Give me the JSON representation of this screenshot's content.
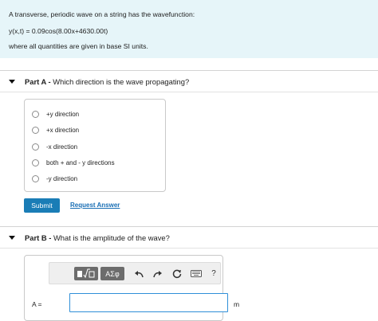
{
  "intro": {
    "line1": "A transverse, periodic wave on a string has the wavefunction:",
    "line2": "y(x,t) = 0.09cos(8.00x+4630.00t)",
    "line3": "where all quantities are given in base SI units."
  },
  "part_a": {
    "label": "Part A -",
    "question": " Which direction is the wave propagating?",
    "options": [
      "+y direction",
      "+x direction",
      "-x direction",
      "both + and - y directions",
      "-y direction"
    ],
    "submit_label": "Submit",
    "request_label": "Request Answer"
  },
  "part_b": {
    "label": "Part B -",
    "question": " What is the amplitude of the wave?",
    "toolbar": {
      "templates_icon": "radical-template-icon",
      "symbols_label": "ΑΣφ",
      "undo_icon": "undo-icon",
      "redo_icon": "redo-icon",
      "reset_icon": "reset-icon",
      "keyboard_icon": "keyboard-icon",
      "help_label": "?"
    },
    "answer_label": "A =",
    "answer_value": "",
    "unit": "m"
  },
  "colors": {
    "intro_bg": "#e6f5f9",
    "submit_bg": "#1a7db6",
    "link": "#1a6fb5",
    "input_border": "#2f8fd8"
  }
}
